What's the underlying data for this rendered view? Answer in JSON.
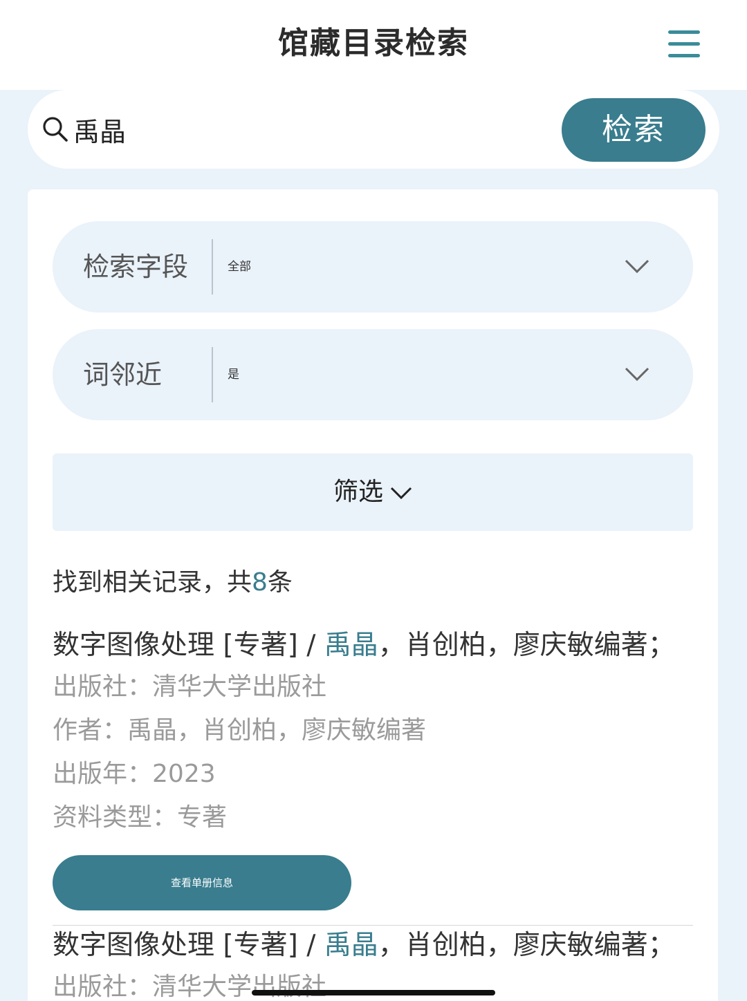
{
  "header": {
    "title": "馆藏目录检索",
    "menu_icon": "menu-icon"
  },
  "search": {
    "value": "禹晶",
    "button_label": "检索",
    "icon": "search-icon"
  },
  "filters": {
    "field": {
      "label": "检索字段",
      "value": "全部"
    },
    "proximity": {
      "label": "词邻近",
      "value": "是"
    },
    "filter_toggle": "筛选"
  },
  "results": {
    "count_prefix": "找到相关记录，共",
    "count": "8",
    "count_suffix": "条",
    "records": [
      {
        "title_prefix": "数字图像处理 [专著] / ",
        "title_highlight": "禹晶",
        "title_suffix": "，肖创柏，廖庆敏编著；",
        "publisher_label": "出版社：",
        "publisher": "清华大学出版社",
        "author_label": "作者：",
        "author": "禹晶，肖创柏，廖庆敏编著",
        "year_label": "出版年：",
        "year": "2023",
        "type_label": "资料类型：",
        "type": "专著",
        "detail_button": "查看单册信息"
      },
      {
        "title_prefix": "数字图像处理 [专著] / ",
        "title_highlight": "禹晶",
        "title_suffix": "，肖创柏，廖庆敏编著；",
        "publisher_label": "出版社：",
        "publisher": "清华大学出版社"
      }
    ]
  },
  "colors": {
    "accent": "#397d8e",
    "background": "#eaf2fa",
    "menu": "#3a8c99"
  }
}
